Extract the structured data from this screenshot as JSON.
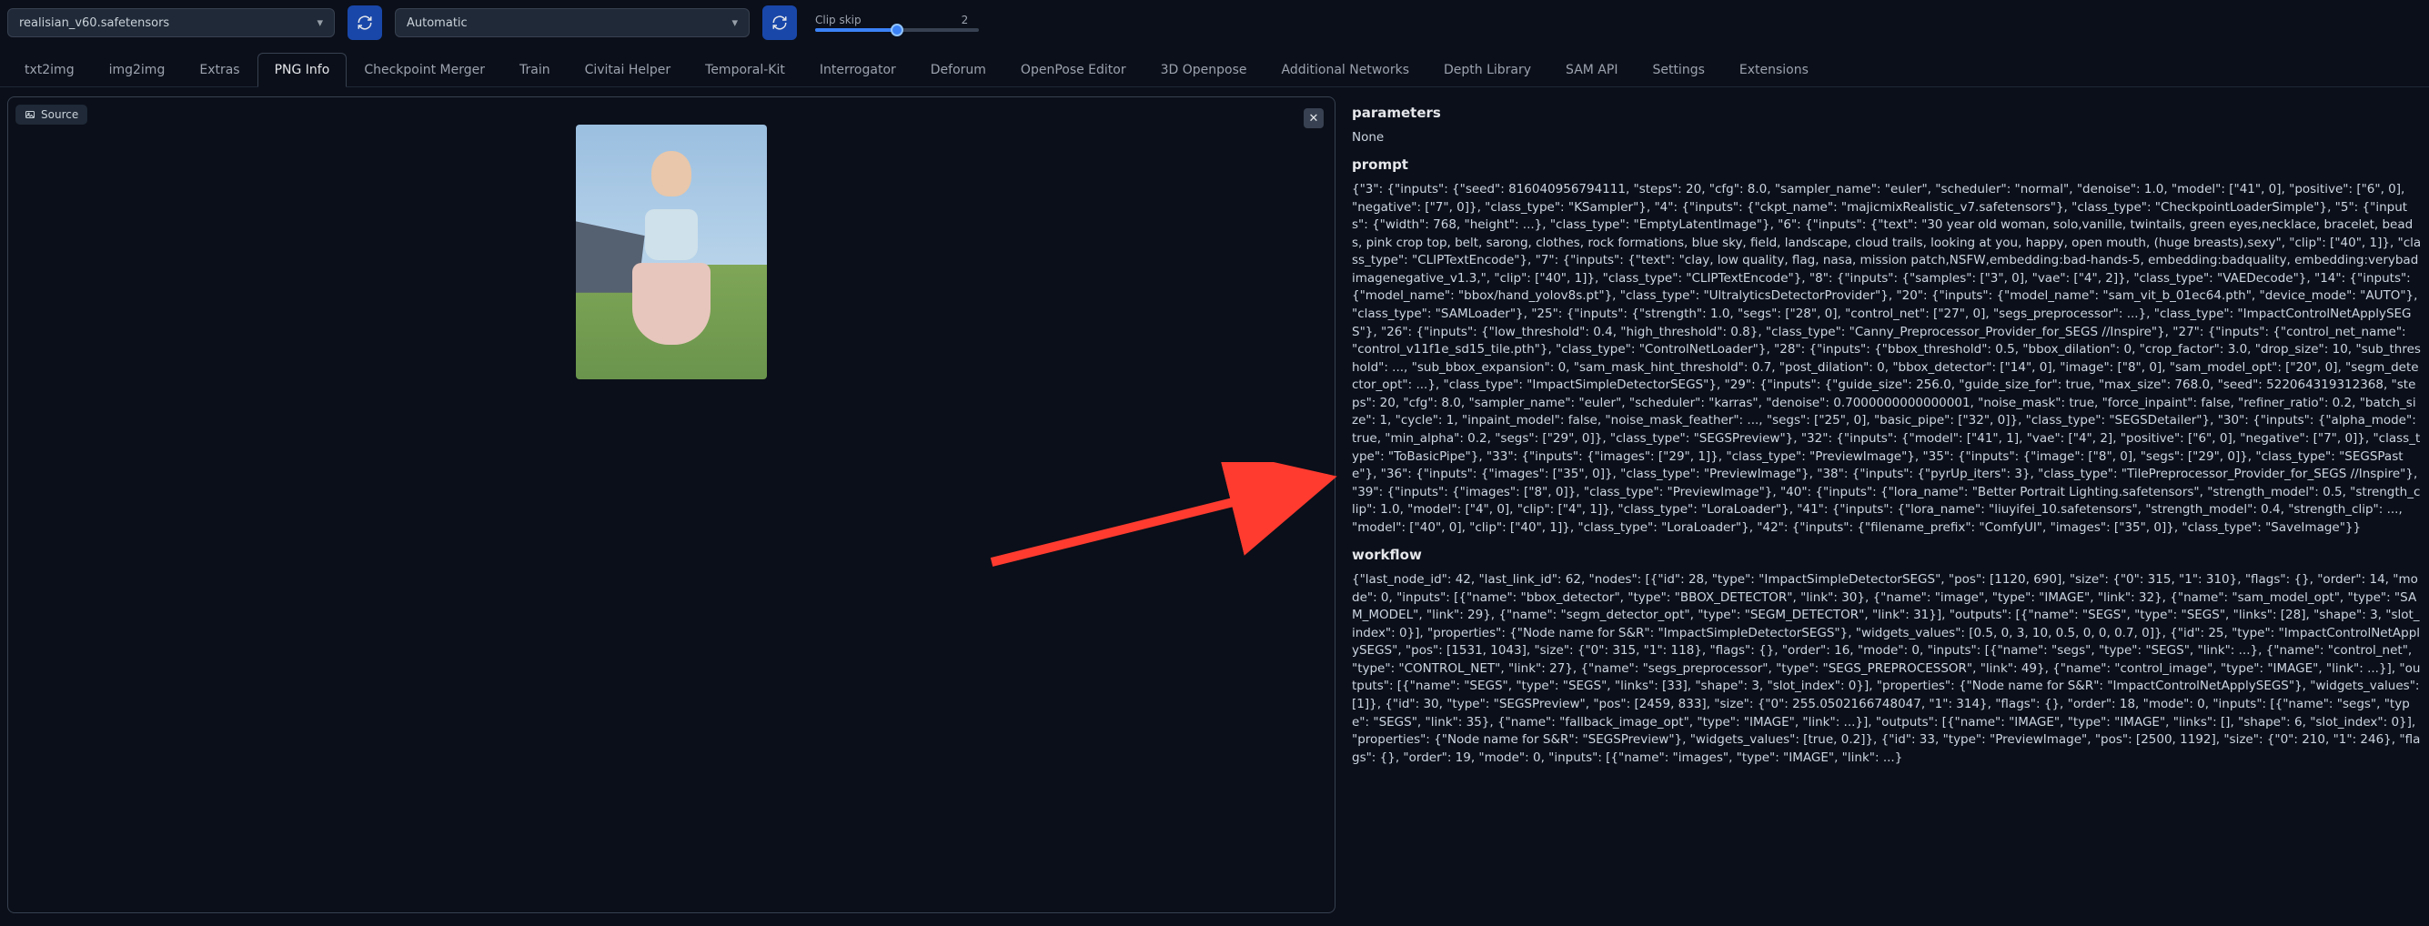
{
  "top": {
    "checkpoint": "realisian_v60.safetensors",
    "vae": "Automatic",
    "clip_label": "Clip skip",
    "clip_value": "2"
  },
  "tabs": [
    "txt2img",
    "img2img",
    "Extras",
    "PNG Info",
    "Checkpoint Merger",
    "Train",
    "Civitai Helper",
    "Temporal-Kit",
    "Interrogator",
    "Deforum",
    "OpenPose Editor",
    "3D Openpose",
    "Additional Networks",
    "Depth Library",
    "SAM API",
    "Settings",
    "Extensions"
  ],
  "active_tab": "PNG Info",
  "source_label": "Source",
  "info": {
    "parameters_h": "parameters",
    "parameters_v": "None",
    "prompt_h": "prompt",
    "prompt_v": "{\"3\": {\"inputs\": {\"seed\": 816040956794111, \"steps\": 20, \"cfg\": 8.0, \"sampler_name\": \"euler\", \"scheduler\": \"normal\", \"denoise\": 1.0, \"model\": [\"41\", 0], \"positive\": [\"6\", 0], \"negative\": [\"7\", 0]}, \"class_type\": \"KSampler\"}, \"4\": {\"inputs\": {\"ckpt_name\": \"majicmixRealistic_v7.safetensors\"}, \"class_type\": \"CheckpointLoaderSimple\"}, \"5\": {\"inputs\": {\"width\": 768, \"height\": ...}, \"class_type\": \"EmptyLatentImage\"}, \"6\": {\"inputs\": {\"text\": \"30 year old woman, solo,vanille, twintails, green eyes,necklace, bracelet, beads, pink crop top, belt, sarong, clothes, rock formations, blue sky, field, landscape, cloud trails, looking at you, happy, open mouth, (huge breasts),sexy\", \"clip\": [\"40\", 1]}, \"class_type\": \"CLIPTextEncode\"}, \"7\": {\"inputs\": {\"text\": \"clay, low quality, flag, nasa, mission patch,NSFW,embedding:bad-hands-5, embedding:badquality, embedding:verybadimagenegative_v1.3,\", \"clip\": [\"40\", 1]}, \"class_type\": \"CLIPTextEncode\"}, \"8\": {\"inputs\": {\"samples\": [\"3\", 0], \"vae\": [\"4\", 2]}, \"class_type\": \"VAEDecode\"}, \"14\": {\"inputs\": {\"model_name\": \"bbox/hand_yolov8s.pt\"}, \"class_type\": \"UltralyticsDetectorProvider\"}, \"20\": {\"inputs\": {\"model_name\": \"sam_vit_b_01ec64.pth\", \"device_mode\": \"AUTO\"}, \"class_type\": \"SAMLoader\"}, \"25\": {\"inputs\": {\"strength\": 1.0, \"segs\": [\"28\", 0], \"control_net\": [\"27\", 0], \"segs_preprocessor\": ...}, \"class_type\": \"ImpactControlNetApplySEGS\"}, \"26\": {\"inputs\": {\"low_threshold\": 0.4, \"high_threshold\": 0.8}, \"class_type\": \"Canny_Preprocessor_Provider_for_SEGS //Inspire\"}, \"27\": {\"inputs\": {\"control_net_name\": \"control_v11f1e_sd15_tile.pth\"}, \"class_type\": \"ControlNetLoader\"}, \"28\": {\"inputs\": {\"bbox_threshold\": 0.5, \"bbox_dilation\": 0, \"crop_factor\": 3.0, \"drop_size\": 10, \"sub_threshold\": ..., \"sub_bbox_expansion\": 0, \"sam_mask_hint_threshold\": 0.7, \"post_dilation\": 0, \"bbox_detector\": [\"14\", 0], \"image\": [\"8\", 0], \"sam_model_opt\": [\"20\", 0], \"segm_detector_opt\": ...}, \"class_type\": \"ImpactSimpleDetectorSEGS\"}, \"29\": {\"inputs\": {\"guide_size\": 256.0, \"guide_size_for\": true, \"max_size\": 768.0, \"seed\": 522064319312368, \"steps\": 20, \"cfg\": 8.0, \"sampler_name\": \"euler\", \"scheduler\": \"karras\", \"denoise\": 0.7000000000000001, \"noise_mask\": true, \"force_inpaint\": false, \"refiner_ratio\": 0.2, \"batch_size\": 1, \"cycle\": 1, \"inpaint_model\": false, \"noise_mask_feather\": ..., \"segs\": [\"25\", 0], \"basic_pipe\": [\"32\", 0]}, \"class_type\": \"SEGSDetailer\"}, \"30\": {\"inputs\": {\"alpha_mode\": true, \"min_alpha\": 0.2, \"segs\": [\"29\", 0]}, \"class_type\": \"SEGSPreview\"}, \"32\": {\"inputs\": {\"model\": [\"41\", 1], \"vae\": [\"4\", 2], \"positive\": [\"6\", 0], \"negative\": [\"7\", 0]}, \"class_type\": \"ToBasicPipe\"}, \"33\": {\"inputs\": {\"images\": [\"29\", 1]}, \"class_type\": \"PreviewImage\"}, \"35\": {\"inputs\": {\"image\": [\"8\", 0], \"segs\": [\"29\", 0]}, \"class_type\": \"SEGSPaste\"}, \"36\": {\"inputs\": {\"images\": [\"35\", 0]}, \"class_type\": \"PreviewImage\"}, \"38\": {\"inputs\": {\"pyrUp_iters\": 3}, \"class_type\": \"TilePreprocessor_Provider_for_SEGS //Inspire\"}, \"39\": {\"inputs\": {\"images\": [\"8\", 0]}, \"class_type\": \"PreviewImage\"}, \"40\": {\"inputs\": {\"lora_name\": \"Better Portrait Lighting.safetensors\", \"strength_model\": 0.5, \"strength_clip\": 1.0, \"model\": [\"4\", 0], \"clip\": [\"4\", 1]}, \"class_type\": \"LoraLoader\"}, \"41\": {\"inputs\": {\"lora_name\": \"liuyifei_10.safetensors\", \"strength_model\": 0.4, \"strength_clip\": ..., \"model\": [\"40\", 0], \"clip\": [\"40\", 1]}, \"class_type\": \"LoraLoader\"}, \"42\": {\"inputs\": {\"filename_prefix\": \"ComfyUI\", \"images\": [\"35\", 0]}, \"class_type\": \"SaveImage\"}}",
    "workflow_h": "workflow",
    "workflow_v": "{\"last_node_id\": 42, \"last_link_id\": 62, \"nodes\": [{\"id\": 28, \"type\": \"ImpactSimpleDetectorSEGS\", \"pos\": [1120, 690], \"size\": {\"0\": 315, \"1\": 310}, \"flags\": {}, \"order\": 14, \"mode\": 0, \"inputs\": [{\"name\": \"bbox_detector\", \"type\": \"BBOX_DETECTOR\", \"link\": 30}, {\"name\": \"image\", \"type\": \"IMAGE\", \"link\": 32}, {\"name\": \"sam_model_opt\", \"type\": \"SAM_MODEL\", \"link\": 29}, {\"name\": \"segm_detector_opt\", \"type\": \"SEGM_DETECTOR\", \"link\": 31}], \"outputs\": [{\"name\": \"SEGS\", \"type\": \"SEGS\", \"links\": [28], \"shape\": 3, \"slot_index\": 0}], \"properties\": {\"Node name for S&R\": \"ImpactSimpleDetectorSEGS\"}, \"widgets_values\": [0.5, 0, 3, 10, 0.5, 0, 0, 0.7, 0]}, {\"id\": 25, \"type\": \"ImpactControlNetApplySEGS\", \"pos\": [1531, 1043], \"size\": {\"0\": 315, \"1\": 118}, \"flags\": {}, \"order\": 16, \"mode\": 0, \"inputs\": [{\"name\": \"segs\", \"type\": \"SEGS\", \"link\": ...}, {\"name\": \"control_net\", \"type\": \"CONTROL_NET\", \"link\": 27}, {\"name\": \"segs_preprocessor\", \"type\": \"SEGS_PREPROCESSOR\", \"link\": 49}, {\"name\": \"control_image\", \"type\": \"IMAGE\", \"link\": ...}], \"outputs\": [{\"name\": \"SEGS\", \"type\": \"SEGS\", \"links\": [33], \"shape\": 3, \"slot_index\": 0}], \"properties\": {\"Node name for S&R\": \"ImpactControlNetApplySEGS\"}, \"widgets_values\": [1]}, {\"id\": 30, \"type\": \"SEGSPreview\", \"pos\": [2459, 833], \"size\": {\"0\": 255.0502166748047, \"1\": 314}, \"flags\": {}, \"order\": 18, \"mode\": 0, \"inputs\": [{\"name\": \"segs\", \"type\": \"SEGS\", \"link\": 35}, {\"name\": \"fallback_image_opt\", \"type\": \"IMAGE\", \"link\": ...}], \"outputs\": [{\"name\": \"IMAGE\", \"type\": \"IMAGE\", \"links\": [], \"shape\": 6, \"slot_index\": 0}], \"properties\": {\"Node name for S&R\": \"SEGSPreview\"}, \"widgets_values\": [true, 0.2]}, {\"id\": 33, \"type\": \"PreviewImage\", \"pos\": [2500, 1192], \"size\": {\"0\": 210, \"1\": 246}, \"flags\": {}, \"order\": 19, \"mode\": 0, \"inputs\": [{\"name\": \"images\", \"type\": \"IMAGE\", \"link\": ...}"
  }
}
